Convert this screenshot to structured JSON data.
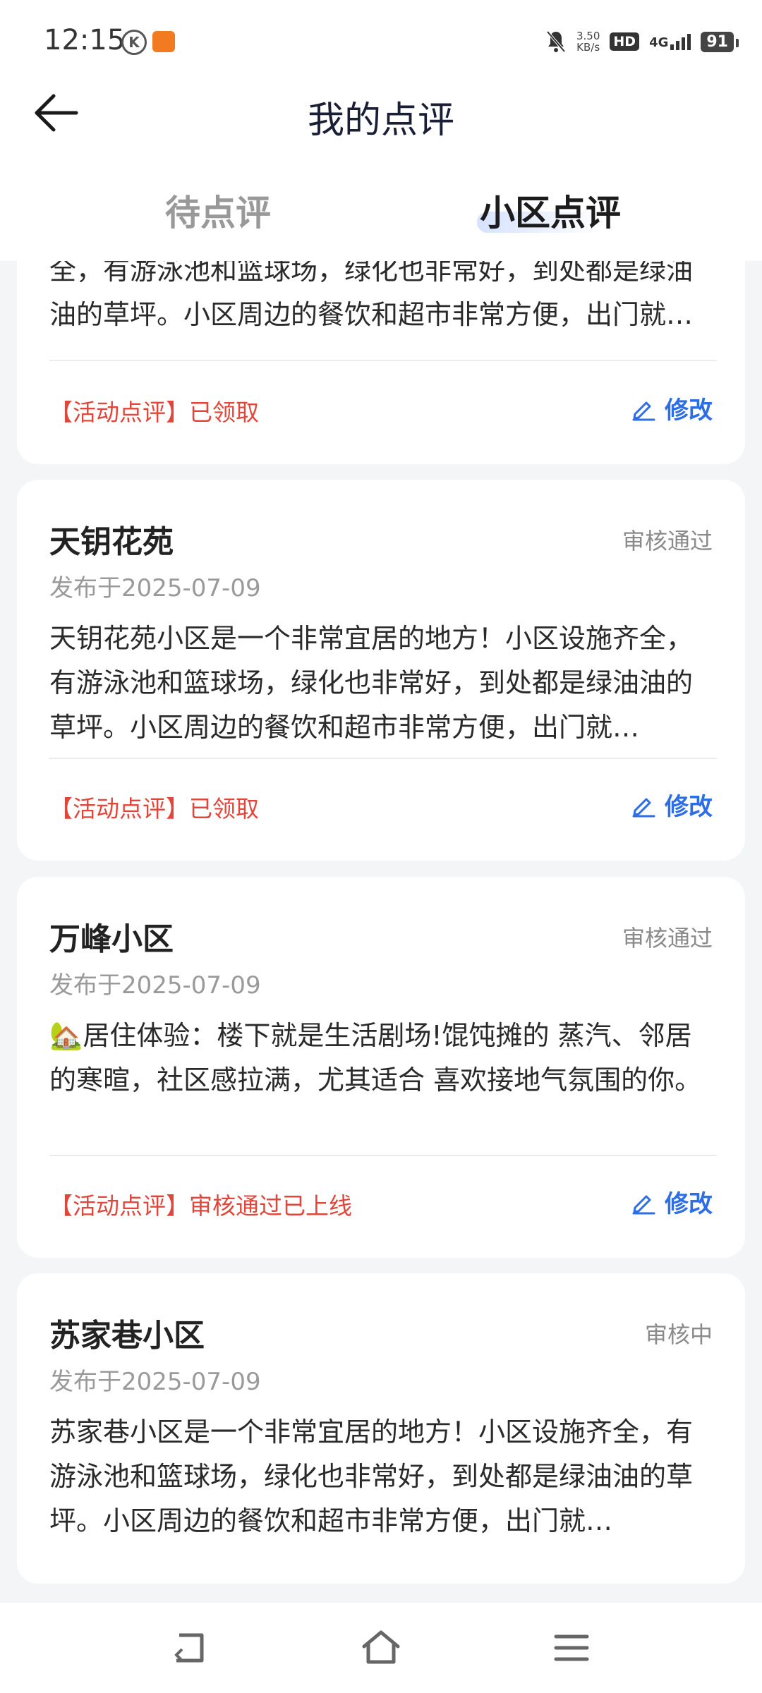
{
  "status_bar": {
    "time": "12:15",
    "k_badge": "K",
    "net_speed_value": "3.50",
    "net_speed_unit": "KB/s",
    "hd_label": "HD",
    "network_type": "4G",
    "battery": "91"
  },
  "header": {
    "title": "我的点评"
  },
  "tabs": [
    {
      "label": "待点评",
      "active": false
    },
    {
      "label": "小区点评",
      "active": true
    }
  ],
  "reviews": [
    {
      "text": "全，有游泳池和篮球场，绿化也非常好，到处都是绿油油的草坪。小区周边的餐饮和超市非常方便，出门就…",
      "tag": "【活动点评】已领取",
      "edit_label": "修改"
    },
    {
      "name": "天钥花苑",
      "status": "审核通过",
      "date": "发布于2025-07-09",
      "text": "天钥花苑小区是一个非常宜居的地方！小区设施齐全，有游泳池和篮球场，绿化也非常好，到处都是绿油油的草坪。小区周边的餐饮和超市非常方便，出门就…",
      "tag": "【活动点评】已领取",
      "edit_label": "修改"
    },
    {
      "name": "万峰小区",
      "status": "审核通过",
      "date": "发布于2025-07-09",
      "text": "🏡居住体验：楼下就是生活剧场!馄饨摊的 蒸汽、邻居的寒暄，社区感拉满，尤其适合 喜欢接地气氛围的你。",
      "tag": "【活动点评】审核通过已上线",
      "edit_label": "修改"
    },
    {
      "name": "苏家巷小区",
      "status": "审核中",
      "date": "发布于2025-07-09",
      "text": "苏家巷小区是一个非常宜居的地方！小区设施齐全，有游泳池和篮球场，绿化也非常好，到处都是绿油油的草坪。小区周边的餐饮和超市非常方便，出门就…"
    }
  ],
  "icons": {
    "back": "back-arrow-icon",
    "edit": "pencil-icon",
    "nav_back": "nav-back-icon",
    "nav_home": "nav-home-icon",
    "nav_menu": "nav-menu-icon"
  },
  "colors": {
    "tag_red": "#e2463b",
    "edit_blue": "#2d6ee6",
    "background": "#f4f5f7"
  }
}
